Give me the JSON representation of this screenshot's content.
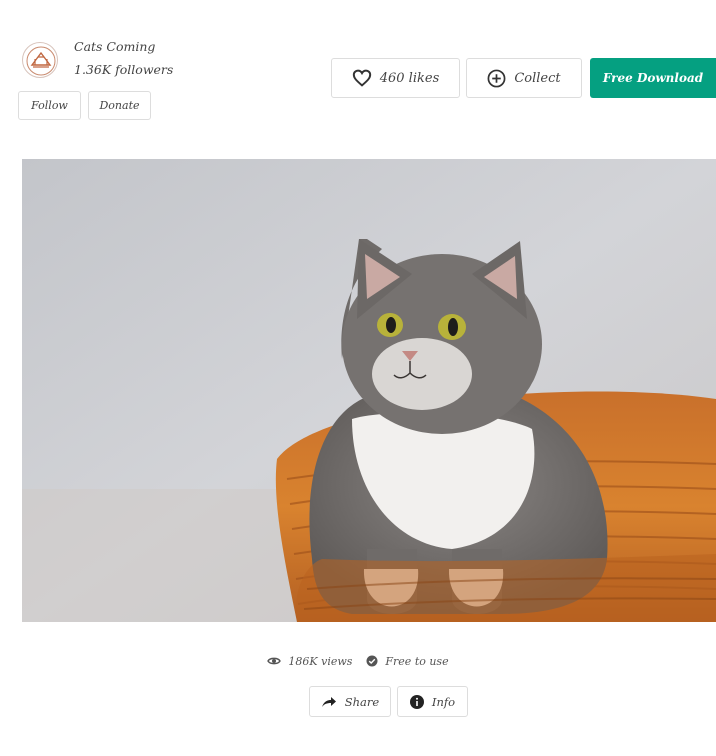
{
  "user": {
    "name": "Cats Coming",
    "followers": "1.36K followers",
    "follow_label": "Follow",
    "donate_label": "Donate"
  },
  "actions": {
    "likes_label": "460 likes",
    "collect_label": "Collect",
    "download_label": "Free Download"
  },
  "photo": {
    "subject": "grey tabby cat with white chest in wicker basket"
  },
  "meta": {
    "views": "186K views",
    "license": "Free to use"
  },
  "footer": {
    "share_label": "Share",
    "info_label": "Info"
  },
  "colors": {
    "accent": "#05a081",
    "border": "#dddddd"
  }
}
